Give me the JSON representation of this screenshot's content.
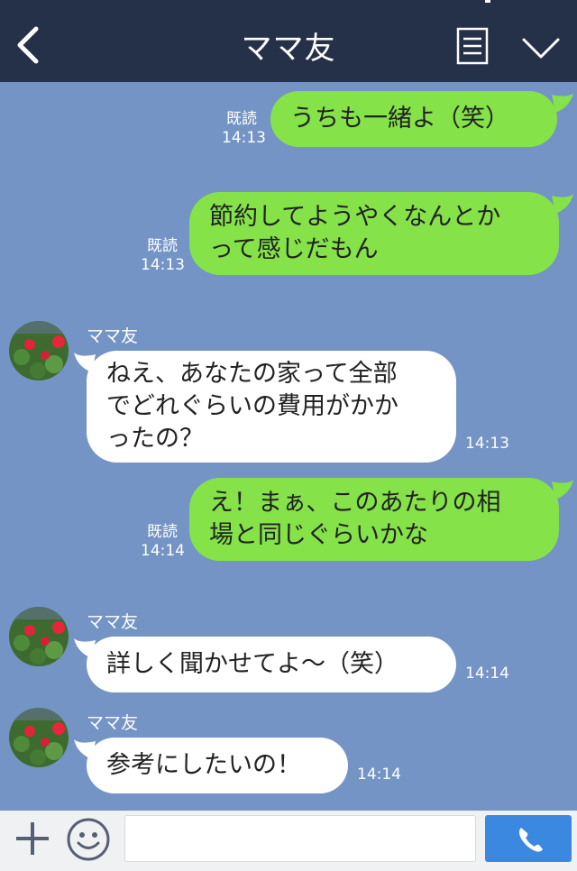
{
  "header": {
    "title": "ママ友"
  },
  "messages": [
    {
      "from": "me",
      "text": "うちも一緒よ（笑）",
      "read": "既読",
      "time": "14:13"
    },
    {
      "from": "me",
      "text": "節約してようやくなんとか\nって感じだもん",
      "read": "既読",
      "time": "14:13"
    },
    {
      "from": "friend",
      "name": "ママ友",
      "text": "ねえ、あなたの家って全部\nでどれぐらいの費用がかか\nったの？",
      "time": "14:13"
    },
    {
      "from": "me",
      "text": "え！まぁ、このあたりの相\n場と同じぐらいかな",
      "read": "既読",
      "time": "14:14"
    },
    {
      "from": "friend",
      "name": "ママ友",
      "text": "詳しく聞かせてよ〜（笑）",
      "time": "14:14"
    },
    {
      "from": "friend",
      "name": "ママ友",
      "text": "参考にしたいの！",
      "time": "14:14"
    }
  ],
  "footer": {
    "input_placeholder": ""
  },
  "colors": {
    "header_bg": "#253049",
    "chat_bg": "#7394c4",
    "sent_bubble": "#85e249",
    "received_bubble": "#ffffff",
    "call_button": "#3b88e0"
  },
  "icons": [
    "back-arrow-icon",
    "memo-icon",
    "chevron-down-icon",
    "plus-icon",
    "smiley-icon",
    "phone-icon"
  ]
}
